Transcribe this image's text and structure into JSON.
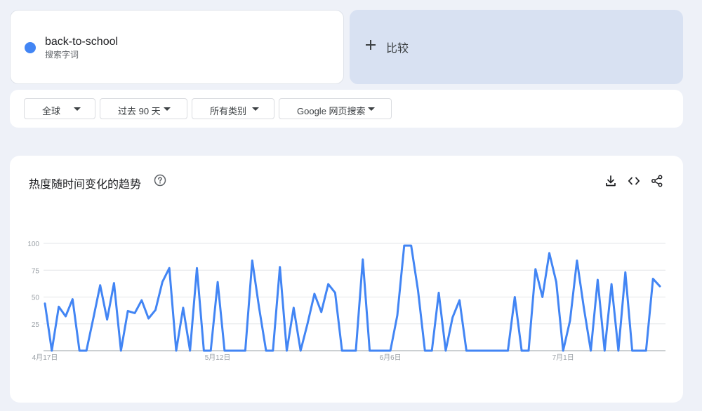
{
  "term": {
    "name": "back-to-school",
    "type_label": "搜索字词",
    "color": "#4285f4"
  },
  "compare": {
    "label": "比较"
  },
  "filters": [
    {
      "label": "全球"
    },
    {
      "label": "过去 90 天"
    },
    {
      "label": "所有类别"
    },
    {
      "label": "Google 网页搜索"
    }
  ],
  "chart_section": {
    "title": "热度随时间变化的趋势",
    "icons": [
      "help-icon",
      "download-icon",
      "embed-icon",
      "share-icon"
    ]
  },
  "chart_data": {
    "type": "line",
    "ylim": [
      0,
      100
    ],
    "yticks": [
      25,
      50,
      75,
      100
    ],
    "ytick_labels": [
      "25",
      "50",
      "75",
      "100"
    ],
    "grid": true,
    "x_tick_labels": [
      {
        "label": "4月17日",
        "index": 0
      },
      {
        "label": "5月12日",
        "index": 25
      },
      {
        "label": "6月6日",
        "index": 50
      },
      {
        "label": "7月1日",
        "index": 75
      }
    ],
    "series": [
      {
        "color": "#4285f4",
        "values": [
          44,
          0,
          41,
          32,
          48,
          0,
          0,
          30,
          61,
          29,
          63,
          0,
          37,
          35,
          47,
          30,
          38,
          64,
          77,
          0,
          40,
          0,
          77,
          0,
          0,
          64,
          0,
          0,
          0,
          0,
          84,
          40,
          0,
          0,
          78,
          0,
          40,
          0,
          25,
          53,
          36,
          62,
          54,
          0,
          0,
          0,
          85,
          0,
          0,
          0,
          0,
          33,
          98,
          98,
          56,
          0,
          0,
          54,
          0,
          31,
          47,
          0,
          0,
          0,
          0,
          0,
          0,
          0,
          50,
          0,
          0,
          76,
          50,
          91,
          64,
          0,
          28,
          84,
          40,
          0,
          66,
          0,
          62,
          0,
          73,
          0,
          0,
          0,
          67,
          60
        ]
      }
    ]
  }
}
